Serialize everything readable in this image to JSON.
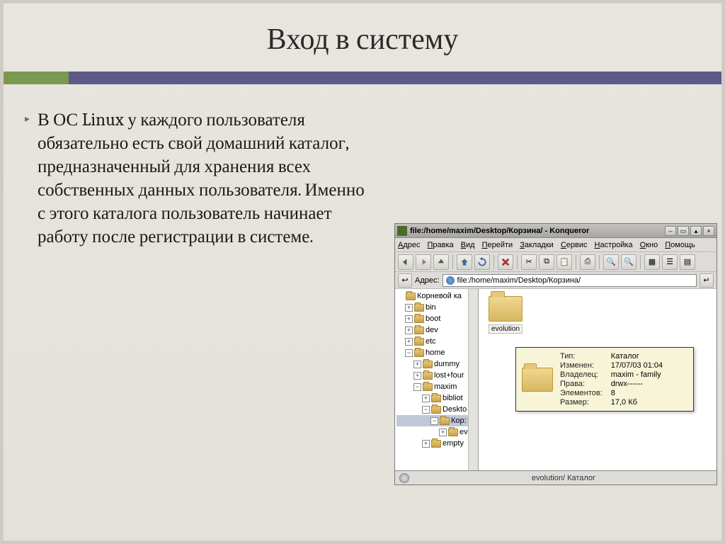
{
  "slide": {
    "title": "Вход в систему",
    "body": "В ОС Linux у каждого пользователя обязательно есть свой домашний каталог, предназначенный для хранения всех собственных данных пользователя. Именно с этого каталога пользователь начинает работу после регистрации в системе."
  },
  "konqueror": {
    "titlebar": "file:/home/maxim/Desktop/Корзина/ - Konqueror",
    "menu": [
      "Адрес",
      "Правка",
      "Вид",
      "Перейти",
      "Закладки",
      "Сервис",
      "Настройка",
      "Окно",
      "Помощь"
    ],
    "address_label": "Адрес:",
    "address_value": "file:/home/maxim/Desktop/Корзина/",
    "tree": [
      {
        "depth": 0,
        "toggle": "",
        "label": "Корневой ка"
      },
      {
        "depth": 1,
        "toggle": "+",
        "label": "bin"
      },
      {
        "depth": 1,
        "toggle": "+",
        "label": "boot"
      },
      {
        "depth": 1,
        "toggle": "+",
        "label": "dev"
      },
      {
        "depth": 1,
        "toggle": "+",
        "label": "etc"
      },
      {
        "depth": 1,
        "toggle": "−",
        "label": "home"
      },
      {
        "depth": 2,
        "toggle": "+",
        "label": "dummy"
      },
      {
        "depth": 2,
        "toggle": "+",
        "label": "lost+four"
      },
      {
        "depth": 2,
        "toggle": "−",
        "label": "maxim"
      },
      {
        "depth": 3,
        "toggle": "+",
        "label": "bibliot"
      },
      {
        "depth": 3,
        "toggle": "−",
        "label": "Deskto"
      },
      {
        "depth": 4,
        "toggle": "−",
        "label": "Кор:",
        "selected": true
      },
      {
        "depth": 5,
        "toggle": "+",
        "label": "ev"
      },
      {
        "depth": 3,
        "toggle": "+",
        "label": "empty"
      }
    ],
    "selected_item": "evolution",
    "tooltip": {
      "rows": [
        {
          "label": "Тип:",
          "value": "Каталог"
        },
        {
          "label": "Изменен:",
          "value": "17/07/03 01:04"
        },
        {
          "label": "Владелец:",
          "value": "maxim - family"
        },
        {
          "label": "Права:",
          "value": "drwx------"
        },
        {
          "label": "Элементов:",
          "value": "8"
        },
        {
          "label": "Размер:",
          "value": "17,0 Кб"
        }
      ]
    },
    "statusbar": "evolution/  Каталог"
  }
}
